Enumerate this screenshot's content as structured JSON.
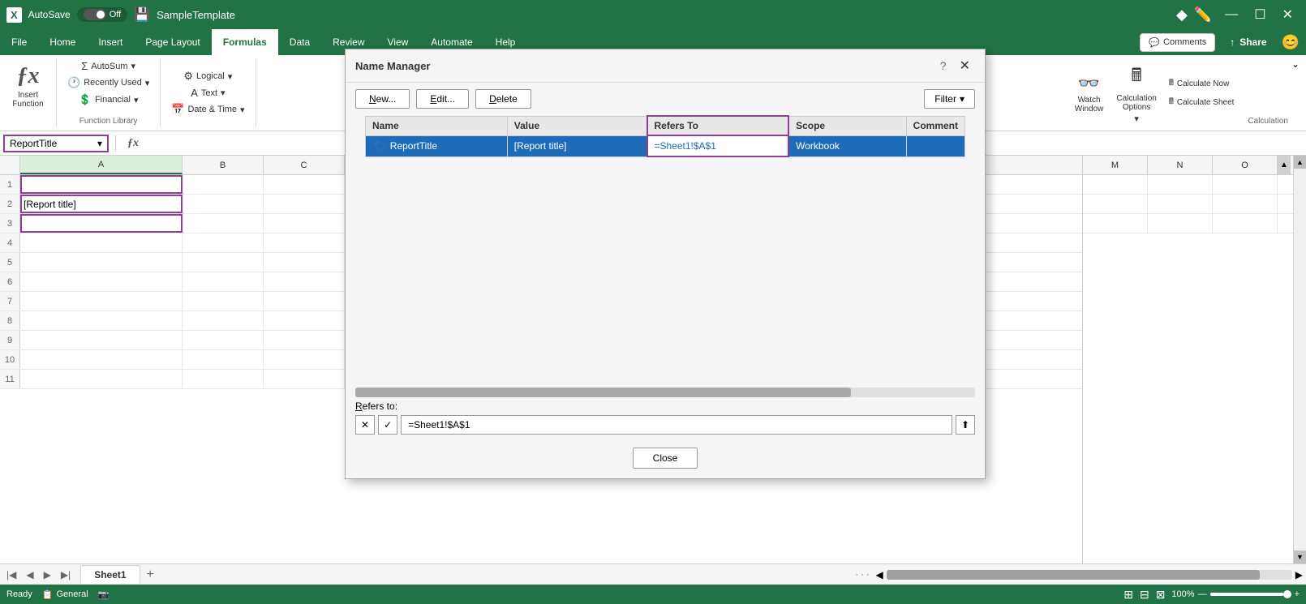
{
  "titleBar": {
    "logo": "X",
    "autosave": "AutoSave",
    "toggleState": "Off",
    "fileName": "SampleTemplate",
    "windowButtons": [
      "—",
      "☐",
      "✕"
    ]
  },
  "ribbon": {
    "tabs": [
      "File",
      "Home",
      "Insert",
      "Page Layout",
      "Formulas",
      "Data",
      "Review",
      "View",
      "Automate",
      "Help"
    ],
    "activeTab": "Formulas",
    "groups": {
      "insertFunction": {
        "icon": "ƒx",
        "label": "Insert\nFunction"
      },
      "autoSum": "AutoSum",
      "recentlyUsed": "Recently Used",
      "financial": "Financial",
      "logical": "Logical",
      "text": "Text",
      "dateTime": "Date & Time",
      "functionLibraryLabel": "Function Library",
      "watchWindow": "Watch\nWindow",
      "calculationOptions": "Calculation\nOptions",
      "calculationLabel": "Calculation"
    }
  },
  "formulaBar": {
    "nameBox": "ReportTitle",
    "formula": ""
  },
  "spreadsheet": {
    "columns": [
      "A",
      "B",
      "C"
    ],
    "rows": [
      {
        "num": 1,
        "cells": [
          "",
          "",
          ""
        ]
      },
      {
        "num": 2,
        "cells": [
          "[Report title]",
          "",
          ""
        ]
      },
      {
        "num": 3,
        "cells": [
          "",
          "",
          ""
        ]
      },
      {
        "num": 4,
        "cells": [
          "",
          "",
          ""
        ]
      },
      {
        "num": 5,
        "cells": [
          "",
          "",
          ""
        ]
      },
      {
        "num": 6,
        "cells": [
          "",
          "",
          ""
        ]
      },
      {
        "num": 7,
        "cells": [
          "",
          "",
          ""
        ]
      },
      {
        "num": 8,
        "cells": [
          "",
          "",
          ""
        ]
      },
      {
        "num": 9,
        "cells": [
          "",
          "",
          ""
        ]
      },
      {
        "num": 10,
        "cells": [
          "",
          "",
          ""
        ]
      },
      {
        "num": 11,
        "cells": [
          "",
          "",
          ""
        ]
      }
    ],
    "rightCols": [
      "M",
      "N",
      "O"
    ]
  },
  "dialog": {
    "title": "Name Manager",
    "buttons": {
      "new": "New...",
      "edit": "Edit...",
      "delete": "Delete",
      "filter": "Filter"
    },
    "tableHeaders": [
      "Name",
      "Value",
      "Refers To",
      "Scope",
      "Comment"
    ],
    "tableRows": [
      {
        "name": "ReportTitle",
        "value": "[Report title]",
        "refersTo": "=Sheet1!$A$1",
        "scope": "Workbook",
        "comment": ""
      }
    ],
    "refersToLabel": "Refers to:",
    "refersToValue": "=Sheet1!$A$1",
    "closeButton": "Close"
  },
  "statusBar": {
    "ready": "Ready",
    "general": "General",
    "zoomLevel": "100%"
  },
  "sheetTabs": {
    "sheets": [
      "Sheet1"
    ],
    "addLabel": "+"
  },
  "rightPanel": {
    "comments": "Comments",
    "share": "Share",
    "watchWindow": "Watch\nWindow",
    "calculationOptions": "Calculation\nOptions"
  }
}
